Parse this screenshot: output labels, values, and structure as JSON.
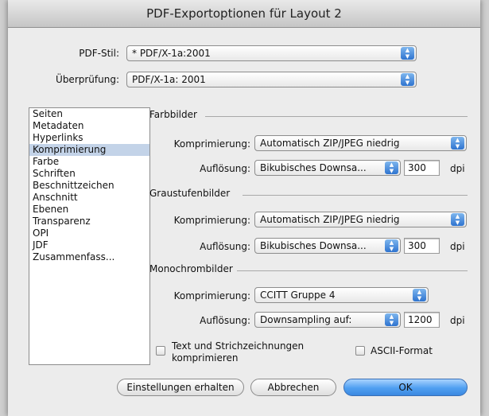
{
  "window": {
    "title": "PDF-Exportoptionen für Layout 2"
  },
  "pdf_stil": {
    "label": "PDF-Stil:",
    "value": "* PDF/X-1a:2001"
  },
  "ueberpruefung": {
    "label": "Überprüfung:",
    "value": "PDF/X-1a: 2001"
  },
  "sidebar": {
    "items": [
      {
        "label": "Seiten"
      },
      {
        "label": "Metadaten"
      },
      {
        "label": "Hyperlinks"
      },
      {
        "label": "Komprimierung"
      },
      {
        "label": "Farbe"
      },
      {
        "label": "Schriften"
      },
      {
        "label": "Beschnittzeichen"
      },
      {
        "label": "Anschnitt"
      },
      {
        "label": "Ebenen"
      },
      {
        "label": "Transparenz"
      },
      {
        "label": "OPI"
      },
      {
        "label": "JDF"
      },
      {
        "label": "Zusammenfass..."
      }
    ],
    "selected": "Komprimierung"
  },
  "farbbilder": {
    "title": "Farbbilder",
    "komprimierung_label": "Komprimierung:",
    "komprimierung_value": "Automatisch ZIP/JPEG niedrig",
    "aufloesung_label": "Auflösung:",
    "aufloesung_value": "Bikubisches Downsa...",
    "dpi_value": "300",
    "dpi_unit": "dpi"
  },
  "graustufenbilder": {
    "title": "Graustufenbilder",
    "komprimierung_label": "Komprimierung:",
    "komprimierung_value": "Automatisch ZIP/JPEG niedrig",
    "aufloesung_label": "Auflösung:",
    "aufloesung_value": "Bikubisches Downsa...",
    "dpi_value": "300",
    "dpi_unit": "dpi"
  },
  "monochrombilder": {
    "title": "Monochrombilder",
    "komprimierung_label": "Komprimierung:",
    "komprimierung_value": "CCITT Gruppe 4",
    "aufloesung_label": "Auflösung:",
    "aufloesung_value": "Downsampling auf:",
    "dpi_value": "1200",
    "dpi_unit": "dpi"
  },
  "options": {
    "text_strich_line1": "Text und Strichzeichnungen",
    "text_strich_line2": "komprimieren",
    "text_strich_checked": false,
    "ascii_format": "ASCII-Format",
    "ascii_checked": false
  },
  "buttons": {
    "keep_settings": "Einstellungen erhalten",
    "cancel": "Abbrechen",
    "ok": "OK"
  },
  "icons": {
    "popup_arrows": "up-down-arrows-icon"
  },
  "colors": {
    "accent": "#3b88e0",
    "selection": "#c3d3e8"
  }
}
